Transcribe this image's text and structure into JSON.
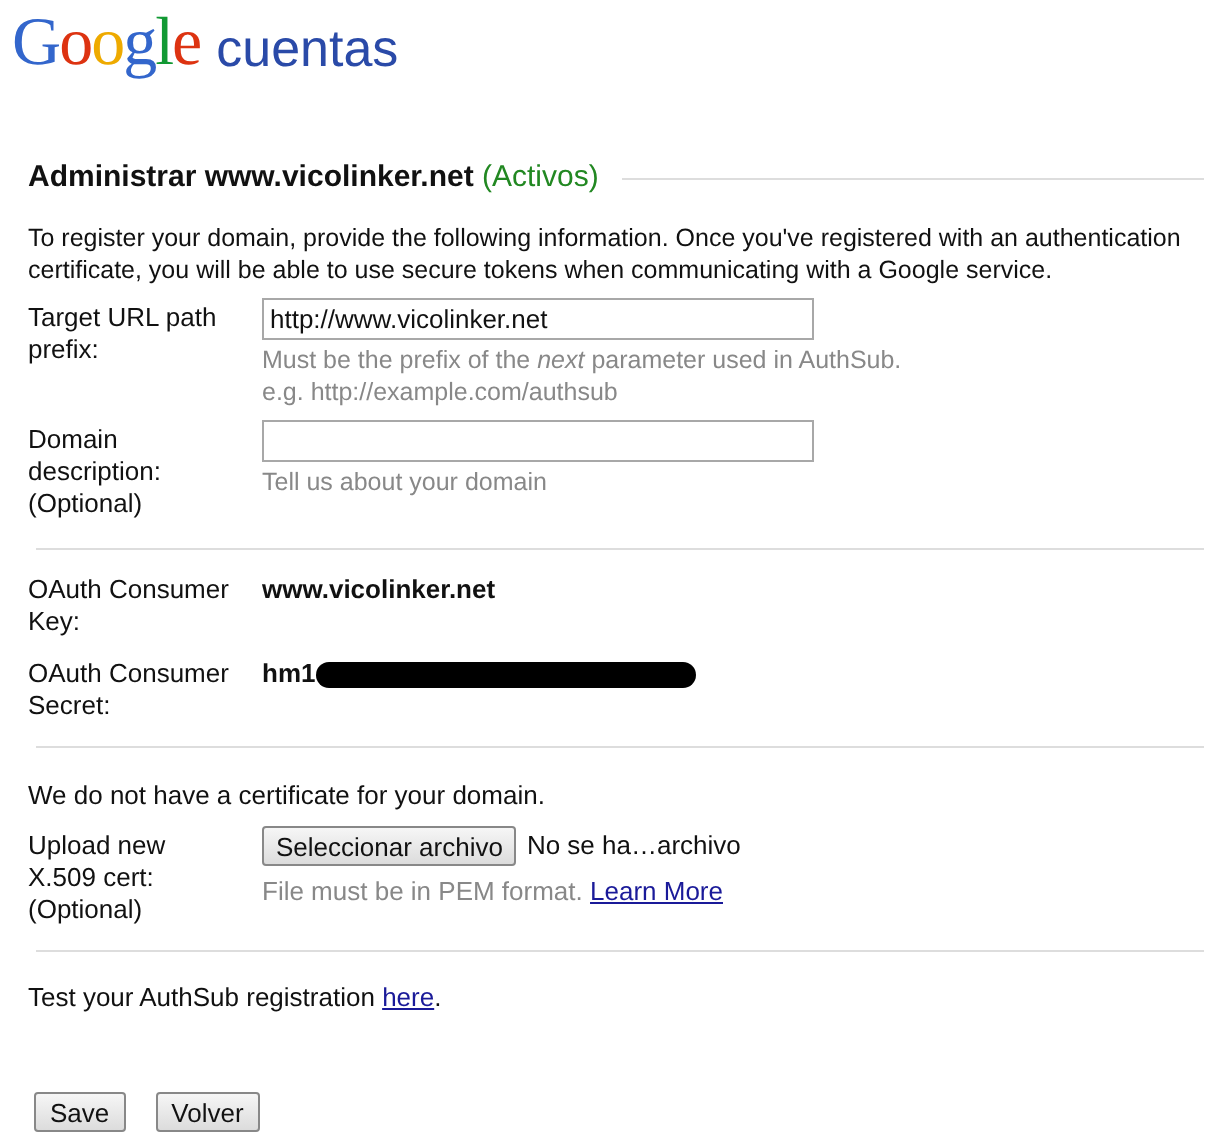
{
  "header": {
    "logo": "Google",
    "product": "cuentas"
  },
  "title": {
    "text": "Administrar www.vicolinker.net",
    "status": "(Activos)"
  },
  "intro": "To register your domain, provide the following information. Once you've registered with an authentication certificate, you will be able to use secure tokens when communicating with a Google service.",
  "fields": [
    {
      "label": "Target URL path prefix:",
      "value": "http://www.vicolinker.net",
      "hints": [
        "Must be the prefix of the *next* parameter used in AuthSub.",
        "e.g. http://example.com/authsub"
      ]
    },
    {
      "label": "Domain description: (Optional)",
      "hints": [
        "Tell us about your domain"
      ]
    }
  ],
  "oauth": [
    {
      "label": "OAuth Consumer Key:",
      "value": "www.vicolinker.net",
      "redacted": false
    },
    {
      "label": "OAuth Consumer Secret:",
      "value": "hm1",
      "redacted": true
    }
  ],
  "certificate": {
    "notice": "We do not have a certificate for your domain.",
    "label": "Upload new X.509 cert: (Optional)",
    "choose_button": "Seleccionar archivo",
    "file_status": "No se ha…archivo",
    "hint": "File must be in PEM format.",
    "link": "Learn More"
  },
  "test": {
    "text": "Test your AuthSub registration",
    "link": "here",
    "after": "."
  },
  "buttons": [
    "Save",
    "Volver"
  ]
}
